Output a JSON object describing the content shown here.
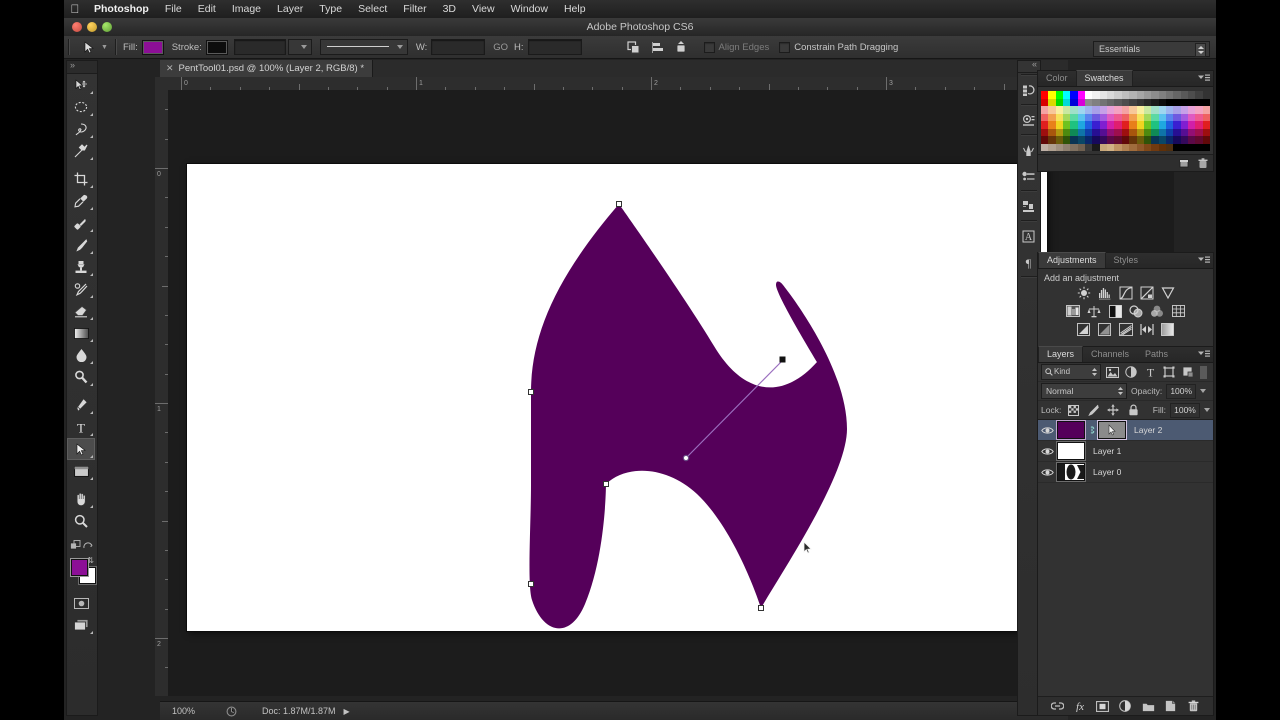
{
  "menubar": {
    "apple_icon": "apple-icon",
    "items": [
      {
        "label": "Photoshop",
        "bold": true
      },
      {
        "label": "File",
        "bold": false
      },
      {
        "label": "Edit",
        "bold": false
      },
      {
        "label": "Image",
        "bold": false
      },
      {
        "label": "Layer",
        "bold": false
      },
      {
        "label": "Type",
        "bold": false
      },
      {
        "label": "Select",
        "bold": false
      },
      {
        "label": "Filter",
        "bold": false
      },
      {
        "label": "3D",
        "bold": false
      },
      {
        "label": "View",
        "bold": false
      },
      {
        "label": "Window",
        "bold": false
      },
      {
        "label": "Help",
        "bold": false
      }
    ]
  },
  "titlebar": {
    "title": "Adobe Photoshop CS6"
  },
  "options_bar": {
    "tool_icon": "path-selection-arrow-icon",
    "fill_label": "Fill:",
    "fill_color": "#8c0f96",
    "stroke_label": "Stroke:",
    "stroke_color": "#0d0d0d",
    "stroke_width_value": "",
    "stroke_style_value": "",
    "w_label": "W:",
    "w_value": "",
    "link_label": "GO",
    "h_label": "H:",
    "h_value": "",
    "path_ops_icon": "path-operations-icon",
    "path_align_icon": "path-alignment-icon",
    "path_arrange_icon": "path-arrangement-icon",
    "align_edges_label": "Align Edges",
    "align_edges_checked": false,
    "constrain_label": "Constrain Path Dragging",
    "constrain_checked": false,
    "workspace_value": "Essentials"
  },
  "toolbox": {
    "tools": [
      {
        "name": "move-tool",
        "selected": false,
        "sub": true
      },
      {
        "name": "elliptical-marquee-tool",
        "selected": false,
        "sub": true
      },
      {
        "name": "lasso-tool",
        "selected": false,
        "sub": true
      },
      {
        "name": "quick-selection-tool",
        "selected": false,
        "sub": true
      },
      {
        "name": "crop-tool",
        "selected": false,
        "sub": true
      },
      {
        "name": "eyedropper-tool",
        "selected": false,
        "sub": true
      },
      {
        "name": "spot-healing-brush-tool",
        "selected": false,
        "sub": true
      },
      {
        "name": "brush-tool",
        "selected": false,
        "sub": true
      },
      {
        "name": "clone-stamp-tool",
        "selected": false,
        "sub": true
      },
      {
        "name": "history-brush-tool",
        "selected": false,
        "sub": true
      },
      {
        "name": "eraser-tool",
        "selected": false,
        "sub": true
      },
      {
        "name": "gradient-tool",
        "selected": false,
        "sub": true
      },
      {
        "name": "blur-tool",
        "selected": false,
        "sub": true
      },
      {
        "name": "dodge-tool",
        "selected": false,
        "sub": true
      },
      {
        "name": "pen-tool",
        "selected": false,
        "sub": true
      },
      {
        "name": "horizontal-type-tool",
        "selected": false,
        "sub": true
      },
      {
        "name": "path-selection-tool",
        "selected": true,
        "sub": true
      },
      {
        "name": "rectangle-tool",
        "selected": false,
        "sub": true
      },
      {
        "name": "hand-tool",
        "selected": false,
        "sub": true
      },
      {
        "name": "zoom-tool",
        "selected": false,
        "sub": false
      }
    ],
    "foreground_color": "#8c0f96",
    "background_color": "#ffffff",
    "quick_mask_icon": "quick-mask-icon",
    "screen_mode_icon": "screen-mode-icon"
  },
  "document": {
    "tab_title": "PentTool01.psd @ 100% (Layer 2, RGB/8) *",
    "close_icon": "close-icon",
    "ruler_h_labels": [
      "0",
      "1",
      "2",
      "3"
    ],
    "ruler_v_labels": [
      "0",
      "1",
      "2"
    ],
    "shape_fill_color": "#55005a",
    "path_stroke_color": "#8c5ab0",
    "cursor_icon": "mouse-pointer-icon"
  },
  "status_bar": {
    "zoom": "100%",
    "grip_icon": "resize-grip-icon",
    "doc_info": "Doc: 1.87M/1.87M",
    "arrow_icon": "expand-arrow-icon"
  },
  "icon_dock": {
    "items": [
      {
        "name": "history-panel-icon"
      },
      {
        "name": "actions-panel-icon"
      },
      {
        "name": "brush-panel-icon"
      },
      {
        "name": "brush-presets-panel-icon"
      },
      {
        "name": "clone-source-panel-icon"
      },
      {
        "name": "character-panel-icon"
      },
      {
        "name": "paragraph-panel-icon"
      }
    ]
  },
  "color_panel": {
    "tabs": [
      {
        "label": "Color",
        "active": false
      },
      {
        "label": "Swatches",
        "active": true
      }
    ],
    "menu_icon": "panel-menu-icon",
    "new_swatch_icon": "new-swatch-icon",
    "delete_swatch_icon": "delete-swatch-icon",
    "swatch_rows": [
      [
        "#ff0000",
        "#ffff00",
        "#00ff00",
        "#00ffff",
        "#0000ff",
        "#ff00ff",
        "#ffffff",
        "#f2f2f2",
        "#e6e6e6",
        "#d9d9d9",
        "#cccccc",
        "#bfbfbf",
        "#b3b3b3",
        "#a6a6a6",
        "#999999",
        "#8c8c8c",
        "#808080",
        "#737373",
        "#666666",
        "#595959",
        "#4d4d4d",
        "#404040",
        "#333333"
      ],
      [
        "#d90000",
        "#d9d900",
        "#00d900",
        "#00d9d9",
        "#0000d9",
        "#d900d9",
        "#8c8c8c",
        "#808080",
        "#737373",
        "#666666",
        "#595959",
        "#4d4d4d",
        "#404040",
        "#333333",
        "#262626",
        "#1a1a1a",
        "#0d0d0d",
        "#000000",
        "#000000",
        "#000000",
        "#000000",
        "#000000",
        "#000000"
      ],
      [
        "#f4a3a3",
        "#f7c89a",
        "#f9efa0",
        "#c9e8a0",
        "#a0e0c8",
        "#9fd6ef",
        "#9fb6ef",
        "#a8a0e8",
        "#c6a0e8",
        "#e8a0d8",
        "#f4a3c2",
        "#f4a3a3",
        "#f7c89a",
        "#f9efa0",
        "#c9e8a0",
        "#a0e0c8",
        "#9fd6ef",
        "#9fb6ef",
        "#a8a0e8",
        "#c6a0e8",
        "#e8a0d8",
        "#f4a3c2",
        "#f4a3a3"
      ],
      [
        "#ef6161",
        "#f2a04f",
        "#f6e25a",
        "#a3d95a",
        "#5ad9a3",
        "#5ac2ef",
        "#5a85ef",
        "#6e5ae0",
        "#a35ae0",
        "#e05ac2",
        "#ef5a90",
        "#ef6161",
        "#f2a04f",
        "#f6e25a",
        "#a3d95a",
        "#5ad9a3",
        "#5ac2ef",
        "#5a85ef",
        "#6e5ae0",
        "#a35ae0",
        "#e05ac2",
        "#ef5a90",
        "#ef6161"
      ],
      [
        "#e01f1f",
        "#e8801a",
        "#f0d420",
        "#6fc21f",
        "#1fc280",
        "#1fa8e0",
        "#1f5fe0",
        "#3a1fd1",
        "#801fd1",
        "#d11fa8",
        "#e01f6f",
        "#e01f1f",
        "#e8801a",
        "#f0d420",
        "#6fc21f",
        "#1fc280",
        "#1fa8e0",
        "#1f5fe0",
        "#3a1fd1",
        "#801fd1",
        "#d11fa8",
        "#e01f6f",
        "#e01f1f"
      ],
      [
        "#9e0f0f",
        "#a8560d",
        "#b09610",
        "#4d8a0f",
        "#0f8a56",
        "#0f74a8",
        "#0f3fa8",
        "#270f93",
        "#560f93",
        "#930f74",
        "#9e0f4d",
        "#9e0f0f",
        "#a8560d",
        "#b09610",
        "#4d8a0f",
        "#0f8a56",
        "#0f74a8",
        "#0f3fa8",
        "#270f93",
        "#560f93",
        "#930f74",
        "#9e0f4d",
        "#9e0f0f"
      ],
      [
        "#610909",
        "#663409",
        "#6b5c0a",
        "#2f5409",
        "#093454",
        "#094766",
        "#09276b",
        "#17095b",
        "#34095b",
        "#5b0947",
        "#61092f",
        "#610909",
        "#663409",
        "#6b5c0a",
        "#2f5409",
        "#093454",
        "#094766",
        "#09276b",
        "#17095b",
        "#34095b",
        "#5b0947",
        "#61092f",
        "#610909"
      ],
      [
        "#bfb0a6",
        "#b0a090",
        "#a09080",
        "#8f8070",
        "#7f7060",
        "#6f6050",
        "#3a3a3a",
        "#1a1a1a",
        "#c8a87a",
        "#d1b184",
        "#c09464",
        "#b08050",
        "#a06c3c",
        "#90582a",
        "#804818",
        "#703a10",
        "#603008",
        "#503010",
        "#000000",
        "#000000",
        "#000000",
        "#000000",
        "#000000"
      ]
    ]
  },
  "adjustments_panel": {
    "tabs": [
      {
        "label": "Adjustments",
        "active": true
      },
      {
        "label": "Styles",
        "active": false
      }
    ],
    "menu_icon": "panel-menu-icon",
    "title": "Add an adjustment",
    "rows": [
      [
        {
          "name": "brightness-contrast-icon"
        },
        {
          "name": "levels-icon"
        },
        {
          "name": "curves-icon"
        },
        {
          "name": "exposure-icon"
        },
        {
          "name": "vibrance-icon"
        }
      ],
      [
        {
          "name": "hue-saturation-icon"
        },
        {
          "name": "color-balance-icon"
        },
        {
          "name": "black-white-icon"
        },
        {
          "name": "photo-filter-icon"
        },
        {
          "name": "channel-mixer-icon"
        },
        {
          "name": "color-lookup-icon"
        }
      ],
      [
        {
          "name": "invert-icon"
        },
        {
          "name": "posterize-icon"
        },
        {
          "name": "threshold-icon"
        },
        {
          "name": "selective-color-icon"
        },
        {
          "name": "gradient-map-icon"
        }
      ]
    ]
  },
  "layers_panel": {
    "tabs": [
      {
        "label": "Layers",
        "active": true
      },
      {
        "label": "Channels",
        "active": false
      },
      {
        "label": "Paths",
        "active": false
      }
    ],
    "menu_icon": "panel-menu-icon",
    "filter_kind_label": "Kind",
    "filter_icons": [
      {
        "name": "filter-pixel-icon"
      },
      {
        "name": "filter-adjustment-icon"
      },
      {
        "name": "filter-type-icon"
      },
      {
        "name": "filter-shape-icon"
      },
      {
        "name": "filter-smart-object-icon"
      }
    ],
    "filter_toggle_icon": "filter-toggle-icon",
    "blend_mode": "Normal",
    "opacity_label": "Opacity:",
    "opacity_value": "100%",
    "lock_label": "Lock:",
    "lock_icons": [
      {
        "name": "lock-transparency-icon"
      },
      {
        "name": "lock-image-icon"
      },
      {
        "name": "lock-position-icon"
      },
      {
        "name": "lock-all-icon"
      }
    ],
    "fill_label": "Fill:",
    "fill_value": "100%",
    "layers": [
      {
        "name": "Layer 2",
        "selected": true,
        "visible": true,
        "thumb_type": "color",
        "thumb_color": "#55005a",
        "has_mask": true,
        "mask_type": "vector"
      },
      {
        "name": "Layer 1",
        "selected": false,
        "visible": true,
        "thumb_type": "white",
        "thumb_color": "#ffffff",
        "has_mask": false,
        "mask_type": ""
      },
      {
        "name": "Layer 0",
        "selected": false,
        "visible": true,
        "thumb_type": "image",
        "thumb_color": "#ffffff",
        "has_mask": false,
        "mask_type": ""
      }
    ],
    "footer_icons": [
      {
        "name": "link-layers-icon"
      },
      {
        "name": "layer-style-fx-icon"
      },
      {
        "name": "add-layer-mask-icon"
      },
      {
        "name": "new-adjustment-layer-icon"
      },
      {
        "name": "new-group-icon"
      },
      {
        "name": "new-layer-icon"
      },
      {
        "name": "delete-layer-icon"
      }
    ]
  }
}
